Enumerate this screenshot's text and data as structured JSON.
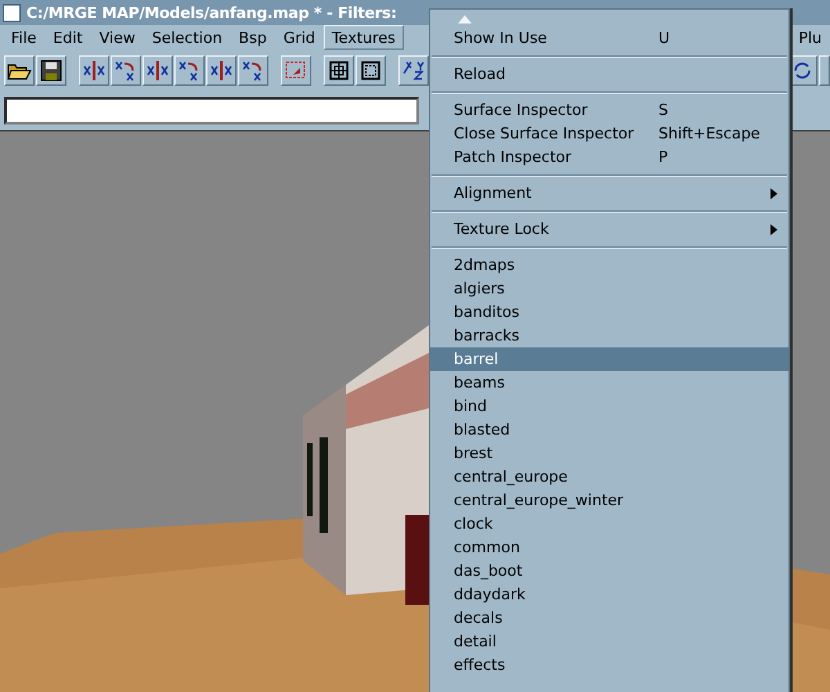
{
  "window": {
    "title": "C:/MRGE MAP/Models/anfang.map * - Filters:"
  },
  "menubar": [
    {
      "label": "File",
      "selected": false
    },
    {
      "label": "Edit",
      "selected": false
    },
    {
      "label": "View",
      "selected": false
    },
    {
      "label": "Selection",
      "selected": false
    },
    {
      "label": "Bsp",
      "selected": false
    },
    {
      "label": "Grid",
      "selected": false
    },
    {
      "label": "Textures",
      "selected": true
    }
  ],
  "menubar_right": {
    "label": "Plu"
  },
  "menu": {
    "items": [
      {
        "kind": "item",
        "label": "Show In Use",
        "shortcut": "U",
        "selected": false
      },
      {
        "kind": "separator"
      },
      {
        "kind": "item",
        "label": "Reload",
        "selected": false
      },
      {
        "kind": "separator"
      },
      {
        "kind": "item",
        "label": "Surface Inspector",
        "shortcut": "S",
        "selected": false
      },
      {
        "kind": "item",
        "label": "Close Surface Inspector",
        "shortcut": "Shift+Escape",
        "selected": false
      },
      {
        "kind": "item",
        "label": "Patch Inspector",
        "shortcut": "P",
        "selected": false
      },
      {
        "kind": "separator"
      },
      {
        "kind": "submenu",
        "label": "Alignment",
        "selected": false
      },
      {
        "kind": "separator"
      },
      {
        "kind": "submenu",
        "label": "Texture Lock",
        "selected": false
      },
      {
        "kind": "separator"
      },
      {
        "kind": "item",
        "label": "2dmaps",
        "selected": false
      },
      {
        "kind": "item",
        "label": "algiers",
        "selected": false
      },
      {
        "kind": "item",
        "label": "banditos",
        "selected": false
      },
      {
        "kind": "item",
        "label": "barracks",
        "selected": false
      },
      {
        "kind": "item",
        "label": "barrel",
        "selected": true
      },
      {
        "kind": "item",
        "label": "beams",
        "selected": false
      },
      {
        "kind": "item",
        "label": "bind",
        "selected": false
      },
      {
        "kind": "item",
        "label": "blasted",
        "selected": false
      },
      {
        "kind": "item",
        "label": "brest",
        "selected": false
      },
      {
        "kind": "item",
        "label": "central_europe",
        "selected": false
      },
      {
        "kind": "item",
        "label": "central_europe_winter",
        "selected": false
      },
      {
        "kind": "item",
        "label": "clock",
        "selected": false
      },
      {
        "kind": "item",
        "label": "common",
        "selected": false
      },
      {
        "kind": "item",
        "label": "das_boot",
        "selected": false
      },
      {
        "kind": "item",
        "label": "ddaydark",
        "selected": false
      },
      {
        "kind": "item",
        "label": "decals",
        "selected": false
      },
      {
        "kind": "item",
        "label": "detail",
        "selected": false
      },
      {
        "kind": "item",
        "label": "effects",
        "selected": false
      }
    ]
  }
}
